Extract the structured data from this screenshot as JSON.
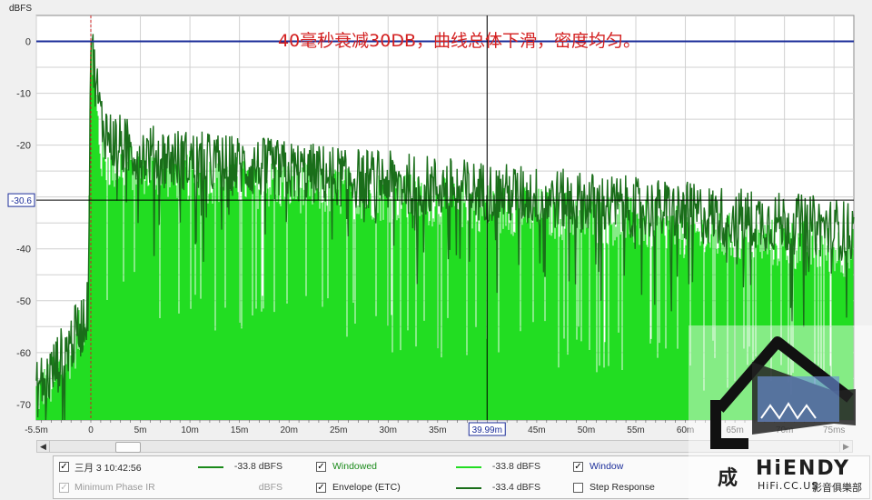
{
  "chart_data": {
    "type": "line",
    "ylabel": "dBFS",
    "xlim": [
      -5.5,
      77
    ],
    "ylim": [
      -73,
      5
    ],
    "x_ticks": [
      "-5.5m",
      "0",
      "5m",
      "10m",
      "15m",
      "20m",
      "25m",
      "30m",
      "35m",
      "40m",
      "45m",
      "50m",
      "55m",
      "60m",
      "65m",
      "70m",
      "75ms"
    ],
    "x_tick_values": [
      -5.5,
      0,
      5,
      10,
      15,
      20,
      25,
      30,
      35,
      40,
      45,
      50,
      55,
      60,
      65,
      70,
      75
    ],
    "y_ticks": [
      "0",
      "-10",
      "-20",
      "-30",
      "-40",
      "-50",
      "-60",
      "-70"
    ],
    "y_tick_values": [
      0,
      -10,
      -20,
      -30,
      -40,
      -50,
      -60,
      -70
    ],
    "grid": true,
    "cursor": {
      "x": 39.99,
      "x_label": "39.99m",
      "y": -30.6,
      "y_label": "-30.6"
    },
    "reference_line": {
      "y": 0,
      "color": "#1c2e9a"
    },
    "window_marker": {
      "x": 0,
      "color": "#cc2222"
    },
    "annotation": "40毫秒衰减30DB，曲线总体下滑，密度均匀。",
    "series": [
      {
        "name": "Windowed",
        "color": "#22dd22",
        "style": "filled-from-bottom",
        "envelope_points": [
          [
            -5.5,
            -68
          ],
          [
            -4,
            -66
          ],
          [
            -3,
            -63
          ],
          [
            -2,
            -60
          ],
          [
            -1,
            -56
          ],
          [
            -0.3,
            -52
          ],
          [
            0,
            0
          ],
          [
            1,
            -22
          ],
          [
            2,
            -24
          ],
          [
            4,
            -24
          ],
          [
            6,
            -25
          ],
          [
            10,
            -26
          ],
          [
            15,
            -27
          ],
          [
            20,
            -28
          ],
          [
            25,
            -29
          ],
          [
            30,
            -30
          ],
          [
            35,
            -31
          ],
          [
            40,
            -32
          ],
          [
            45,
            -33
          ],
          [
            50,
            -34
          ],
          [
            55,
            -35
          ],
          [
            60,
            -37
          ],
          [
            65,
            -38
          ],
          [
            70,
            -39
          ],
          [
            75,
            -40
          ],
          [
            77,
            -41
          ]
        ]
      },
      {
        "name": "Envelope (ETC)",
        "color": "#1a6e1a",
        "style": "line",
        "envelope_points": [
          [
            -5.5,
            -67
          ],
          [
            -4,
            -64
          ],
          [
            -3,
            -61
          ],
          [
            -2,
            -58
          ],
          [
            -1,
            -55
          ],
          [
            -0.3,
            -52
          ],
          [
            0,
            0
          ],
          [
            1,
            -15
          ],
          [
            2,
            -19
          ],
          [
            4,
            -21
          ],
          [
            6,
            -22
          ],
          [
            10,
            -23
          ],
          [
            15,
            -24
          ],
          [
            20,
            -25
          ],
          [
            25,
            -26
          ],
          [
            30,
            -27
          ],
          [
            35,
            -28
          ],
          [
            40,
            -29
          ],
          [
            45,
            -30
          ],
          [
            50,
            -31
          ],
          [
            55,
            -32
          ],
          [
            60,
            -33
          ],
          [
            65,
            -34
          ],
          [
            70,
            -35
          ],
          [
            75,
            -36
          ],
          [
            77,
            -37
          ]
        ]
      }
    ]
  },
  "ui": {
    "ylabel": "dBFS",
    "annotation": "40毫秒衰减30DB，曲线总体下滑，密度均匀。",
    "scroll_left": "◀",
    "scroll_right": "▶",
    "logo": {
      "text": "HiENDY",
      "sub": "HiFi.CC.US",
      "cn": "成",
      "cn2": "影音俱樂部"
    }
  },
  "legend": {
    "rows": [
      {
        "check": "✓",
        "label": "三月 3 10:42:56",
        "color": "#1a8a1a",
        "value": "-33.8 dBFS",
        "dim": false
      },
      {
        "check": "✓",
        "label": "Windowed",
        "color": "#22dd22",
        "value": "-33.8 dBFS",
        "dim": false
      },
      {
        "check": "✓",
        "label": "Window",
        "color": "#1c2e9a",
        "value": "",
        "dim": false
      },
      {
        "check": "✓",
        "label": "Minimum Phase IR",
        "color": "",
        "value": "dBFS",
        "dim": true
      },
      {
        "check": "✓",
        "label": "Envelope (ETC)",
        "color": "#1a6e1a",
        "value": "-33.4 dBFS",
        "dim": false
      },
      {
        "check": "",
        "label": "Step Response",
        "color": "",
        "value": "",
        "dim": false
      }
    ]
  },
  "colors": {
    "plot_bg": "#ffffff",
    "grid": "#d0d0d0",
    "axis_text": "#333333"
  }
}
